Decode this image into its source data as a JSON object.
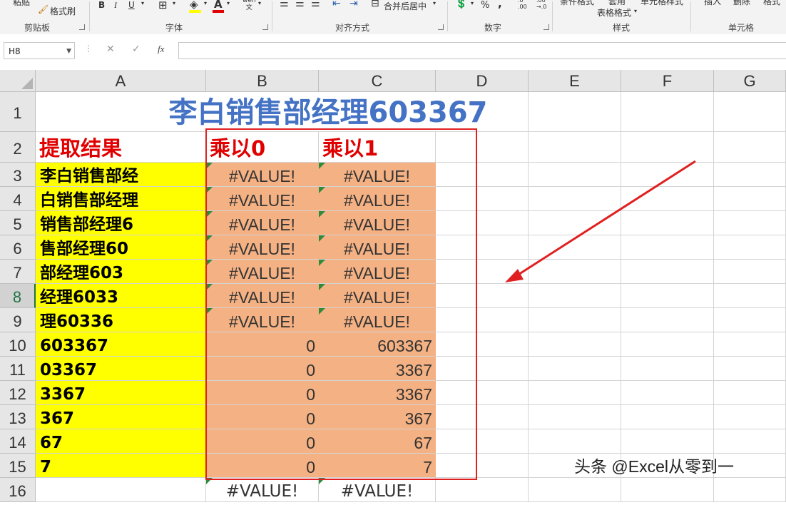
{
  "ribbon": {
    "paste_label": "粘贴",
    "format_painter_label": "格式刷",
    "bold": "B",
    "italic": "I",
    "underline": "U",
    "merge_center_label": "合并后居中",
    "percent": "%",
    "comma": ",",
    "conditional_format_label": "条件格式",
    "table_format_line1": "套用",
    "table_format_line2": "表格格式",
    "cell_styles_label": "单元格样式",
    "insert_label": "插入",
    "delete_label": "删除",
    "format_label": "格式",
    "groups": {
      "clipboard": "剪贴板",
      "font": "字体",
      "alignment": "对齐方式",
      "number": "数字",
      "styles": "样式",
      "cells": "单元格"
    }
  },
  "formula_bar": {
    "name_box": "H8",
    "cancel": "✕",
    "enter": "✓",
    "fx": "fx",
    "value": ""
  },
  "columns": [
    "A",
    "B",
    "C",
    "D",
    "E",
    "F",
    "G"
  ],
  "rows": [
    "1",
    "2",
    "3",
    "4",
    "5",
    "6",
    "7",
    "8",
    "9",
    "10",
    "11",
    "12",
    "13",
    "14",
    "15",
    "16"
  ],
  "selected_row": "8",
  "sheet": {
    "title": "李白销售部经理603367",
    "a2": "提取结果",
    "b2": "乘以0",
    "c2": "乘以1",
    "col_a": [
      "李白销售部经",
      "白销售部经理",
      "销售部经理6",
      "售部经理60",
      "部经理603",
      "经理6033",
      "理60336",
      "603367",
      "03367",
      "3367",
      "367",
      "67",
      "7"
    ],
    "col_b": [
      "#VALUE!",
      "#VALUE!",
      "#VALUE!",
      "#VALUE!",
      "#VALUE!",
      "#VALUE!",
      "#VALUE!",
      "0",
      "0",
      "0",
      "0",
      "0",
      "0"
    ],
    "col_c": [
      "#VALUE!",
      "#VALUE!",
      "#VALUE!",
      "#VALUE!",
      "#VALUE!",
      "#VALUE!",
      "#VALUE!",
      "603367",
      "3367",
      "3367",
      "367",
      "67",
      "7"
    ],
    "b16": "#VALUE!",
    "c16": "#VALUE!"
  },
  "colors": {
    "title": "#4472c4",
    "header_red": "#e00000",
    "yellow_fill": "#ffff00",
    "orange_fill": "#f4b183",
    "annotation_red": "#e02020"
  },
  "watermark": "头条 @Excel从零到一"
}
